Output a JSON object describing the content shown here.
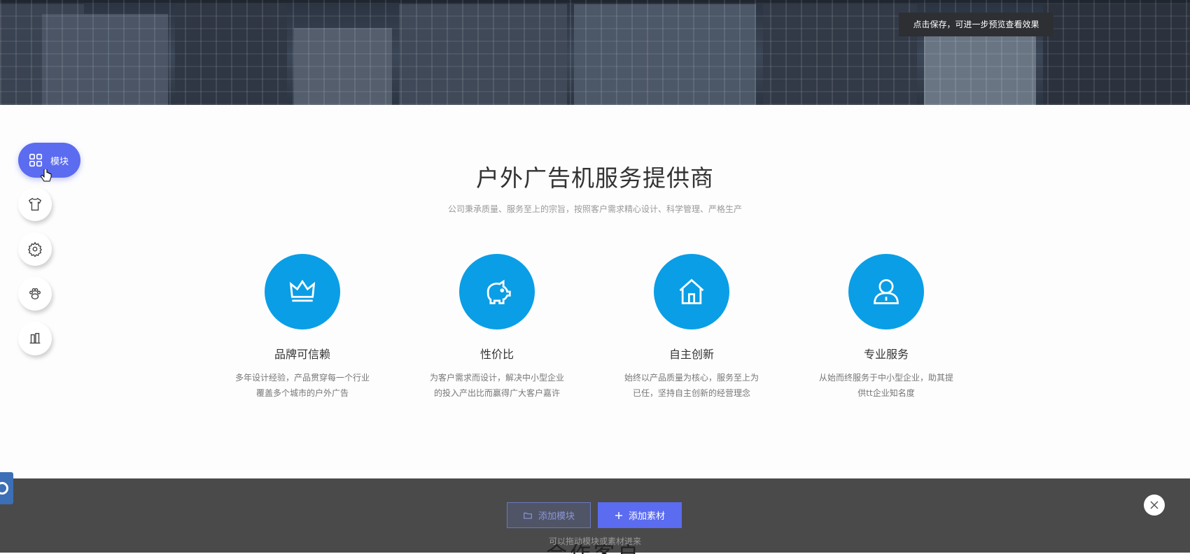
{
  "banner": {
    "tip": "点击保存，可进一步预览查看效果"
  },
  "toolbar": {
    "module_label": "模块",
    "tools": [
      "shirt-icon",
      "gear-icon",
      "paw-icon",
      "book-icon"
    ]
  },
  "main": {
    "title": "户外广告机服务提供商",
    "subtitle": "公司秉承质量、服务至上的宗旨，按照客户需求精心设计、科学管理、严格生产",
    "features": [
      {
        "icon": "crown-icon",
        "title": "品牌可信赖",
        "line1": "多年设计经验，产品贯穿每一个行业",
        "line2": "覆盖多个城市的户外广告"
      },
      {
        "icon": "piggy-bank-icon",
        "title": "性价比",
        "line1": "为客户需求而设计，解决中小型企业",
        "line2": "的投入产出比而赢得广大客户嘉许"
      },
      {
        "icon": "home-icon",
        "title": "自主创新",
        "line1": "始终以产品质量为核心，服务至上为",
        "line2": "已任，坚持自主创新的经营理念"
      },
      {
        "icon": "user-icon",
        "title": "专业服务",
        "line1": "从始而终服务于中小型企业，助其提",
        "line2": "供tt企业知名度"
      }
    ]
  },
  "editor_bar": {
    "add_module": "添加模块",
    "add_material": "添加素材",
    "hint": "可以拖动模块或素材进来",
    "peek_text": "合作客户"
  },
  "colors": {
    "accent": "#5b6cf0",
    "feature_circle": "#0a9ee6",
    "bottom_bar": "#4a4a4a"
  }
}
